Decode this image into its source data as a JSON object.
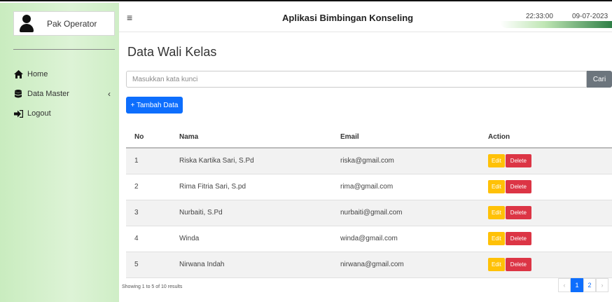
{
  "sidebar": {
    "user_name": "Pak Operator",
    "items": [
      {
        "label": "Home",
        "icon": "home-icon"
      },
      {
        "label": "Data Master",
        "icon": "database-icon",
        "chevron": "‹"
      },
      {
        "label": "Logout",
        "icon": "logout-icon"
      }
    ]
  },
  "header": {
    "menu_icon": "≡",
    "title": "Aplikasi Bimbingan Konseling",
    "time": "22:33:00",
    "date": "09-07-2023"
  },
  "main": {
    "page_title": "Data Wali Kelas",
    "search": {
      "placeholder": "Masukkan kata kunci",
      "button": "Cari"
    },
    "add_button": "+ Tambah Data",
    "table": {
      "headers": [
        "No",
        "Nama",
        "Email",
        "Action"
      ],
      "rows": [
        {
          "no": "1",
          "nama": "Riska Kartika Sari, S.Pd",
          "email": "riska@gmail.com"
        },
        {
          "no": "2",
          "nama": "Rima Fitria Sari, S.pd",
          "email": "rima@gmail.com"
        },
        {
          "no": "3",
          "nama": "Nurbaiti, S.Pd",
          "email": "nurbaiti@gmail.com"
        },
        {
          "no": "4",
          "nama": "Winda",
          "email": "winda@gmail.com"
        },
        {
          "no": "5",
          "nama": "Nirwana Indah",
          "email": "nirwana@gmail.com"
        }
      ],
      "edit_label": "Edit",
      "delete_label": "Delete"
    },
    "footer_info": "Showing 1 to 5 of 10 results",
    "pagination": {
      "prev": "‹",
      "pages": [
        "1",
        "2"
      ],
      "next": "›",
      "current": "1"
    }
  },
  "colors": {
    "sidebar_bg": "#d3efcb",
    "primary": "#0d6efd",
    "warning": "#ffc107",
    "danger": "#dc3545",
    "secondary": "#6c757d"
  }
}
